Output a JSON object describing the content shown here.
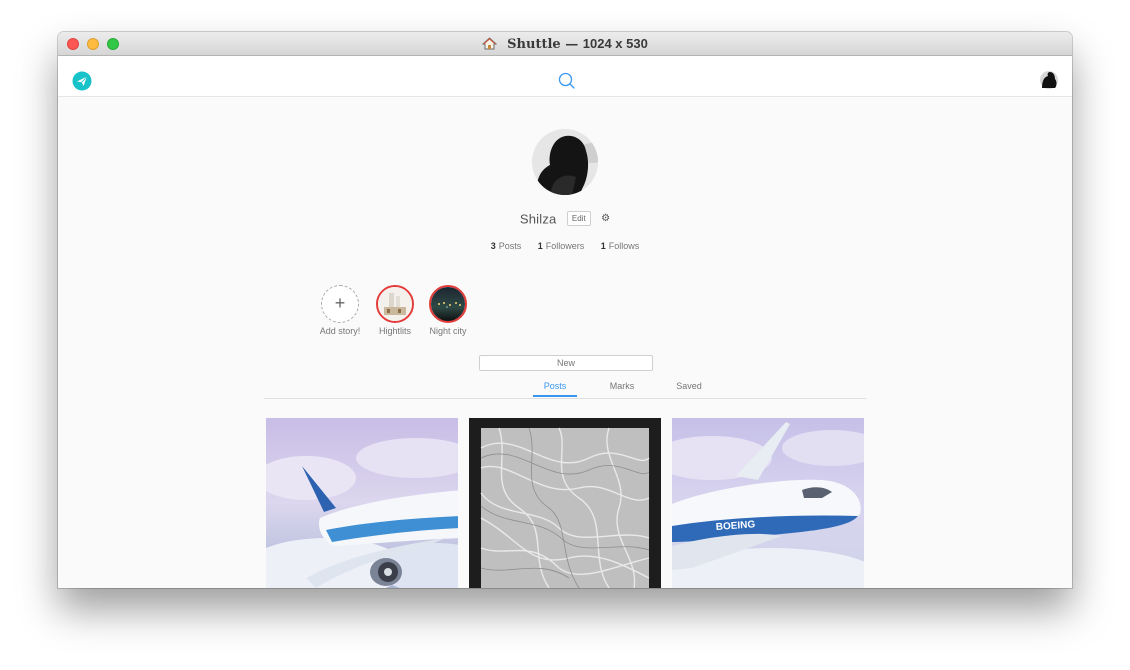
{
  "window": {
    "title": "Shuttle",
    "separator": "—",
    "size_text": "1024 x 530"
  },
  "header": {
    "logo_icon": "paper-plane-icon",
    "search_icon": "search-icon",
    "accent": "#3897f0",
    "logo_color": "#18c2c9"
  },
  "profile": {
    "username": "Shilza",
    "edit_label": "Edit",
    "settings_icon": "gear-icon",
    "stats": [
      {
        "count": "3",
        "label": "Posts"
      },
      {
        "count": "1",
        "label": "Followers"
      },
      {
        "count": "1",
        "label": "Follows"
      }
    ]
  },
  "stories": [
    {
      "label": "Add story!",
      "symbol": "+"
    },
    {
      "label": "Hightlits"
    },
    {
      "label": "Night city"
    }
  ],
  "new_label": "New",
  "tabs": [
    {
      "label": "Posts",
      "active": true
    },
    {
      "label": "Marks",
      "active": false
    },
    {
      "label": "Saved",
      "active": false
    }
  ],
  "posts": [
    {
      "subject": "airplane-photo"
    },
    {
      "subject": "wavy-texture-photo"
    },
    {
      "subject": "airplane-photo",
      "caption": "BOEING"
    }
  ]
}
